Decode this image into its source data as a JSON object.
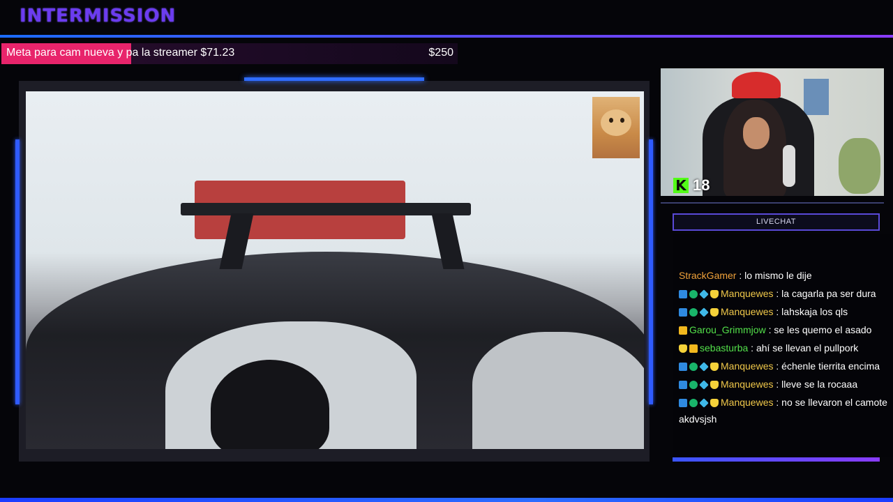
{
  "header": {
    "title": "INTERMISSION"
  },
  "goal": {
    "label": "Meta para cam nueva y pa la streamer $71.23",
    "target": "$250",
    "progress_fraction": 0.285
  },
  "webcam": {
    "viewer_count": "18",
    "platform_icon": "kick-icon"
  },
  "chat": {
    "title": "LIVECHAT",
    "messages": [
      {
        "user": "StrackGamer",
        "text": " : lo mismo le dije",
        "badges": []
      },
      {
        "user": "Manquewes",
        "text": " : la cagarla pa ser dura",
        "badges": [
          "moderator-icon",
          "verified-icon",
          "gem-icon",
          "subscriber-icon"
        ]
      },
      {
        "user": "Manquewes",
        "text": " : lahskaja los qls",
        "badges": [
          "moderator-icon",
          "verified-icon",
          "gem-icon",
          "subscriber-icon"
        ]
      },
      {
        "user": "Garou_Grimmjow",
        "text": " : se les quemo el asado",
        "badges": [
          "crown-icon"
        ]
      },
      {
        "user": "sebasturba",
        "text": " : ahí se llevan el pullpork",
        "badges": [
          "subscriber-icon",
          "crown-icon"
        ]
      },
      {
        "user": "Manquewes",
        "text": " : échenle tierrita encima",
        "badges": [
          "moderator-icon",
          "verified-icon",
          "gem-icon",
          "subscriber-icon"
        ]
      },
      {
        "user": "Manquewes",
        "text": " : lleve se la rocaaa",
        "badges": [
          "moderator-icon",
          "verified-icon",
          "gem-icon",
          "subscriber-icon"
        ]
      },
      {
        "user": "Manquewes",
        "text": " : no se llevaron el camote",
        "badges": [
          "moderator-icon",
          "verified-icon",
          "gem-icon",
          "subscriber-icon"
        ]
      }
    ],
    "continuation": "akdvsjsh"
  }
}
